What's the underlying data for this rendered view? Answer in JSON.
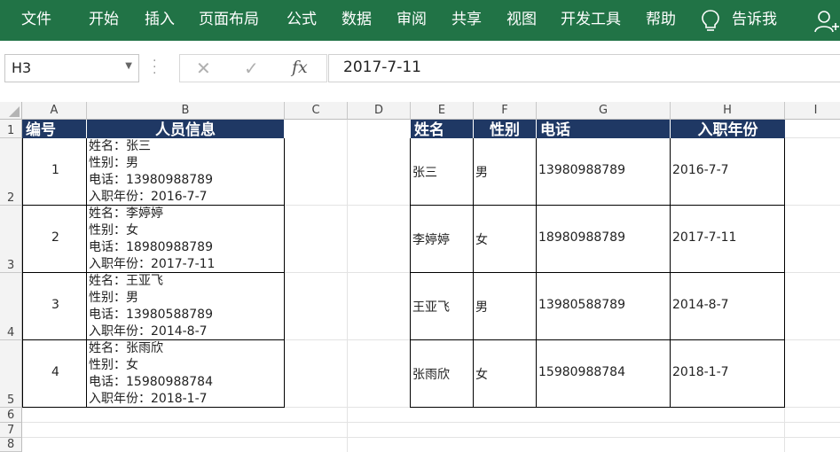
{
  "ribbon": {
    "tabs": [
      "文件",
      "开始",
      "插入",
      "页面布局",
      "公式",
      "数据",
      "审阅",
      "共享",
      "视图",
      "开发工具",
      "帮助"
    ],
    "tell_me": "告诉我"
  },
  "formula_bar": {
    "name_box": "H3",
    "formula": "2017-7-11",
    "fx_label": "fx"
  },
  "columns": [
    "A",
    "B",
    "C",
    "D",
    "E",
    "F",
    "G",
    "H",
    "I"
  ],
  "rows": [
    "1",
    "2",
    "3",
    "4",
    "5",
    "6",
    "7",
    "8"
  ],
  "table1": {
    "headers": [
      "编号",
      "人员信息"
    ],
    "rows": [
      {
        "id": "1",
        "lines": [
          "姓名：张三",
          "性别：男",
          "电话：13980988789",
          "入职年份：2016-7-7"
        ]
      },
      {
        "id": "2",
        "lines": [
          "姓名：李婷婷",
          "性别：女",
          "电话：18980988789",
          "入职年份：2017-7-11"
        ]
      },
      {
        "id": "3",
        "lines": [
          "姓名：王亚飞",
          "性别：男",
          "电话：13980588789",
          "入职年份：2014-8-7"
        ]
      },
      {
        "id": "4",
        "lines": [
          "姓名：张雨欣",
          "性别：女",
          "电话：15980988784",
          "入职年份：2018-1-7"
        ]
      }
    ]
  },
  "table2": {
    "headers": [
      "姓名",
      "性别",
      "电话",
      "入职年份"
    ],
    "rows": [
      [
        "张三",
        "男",
        "13980988789",
        "2016-7-7"
      ],
      [
        "李婷婷",
        "女",
        "18980988789",
        "2017-7-11"
      ],
      [
        "王亚飞",
        "男",
        "13980588789",
        "2014-8-7"
      ],
      [
        "张雨欣",
        "女",
        "15980988784",
        "2018-1-7"
      ]
    ]
  },
  "colors": {
    "ribbon": "#217346",
    "header_fill": "#1f3864"
  }
}
